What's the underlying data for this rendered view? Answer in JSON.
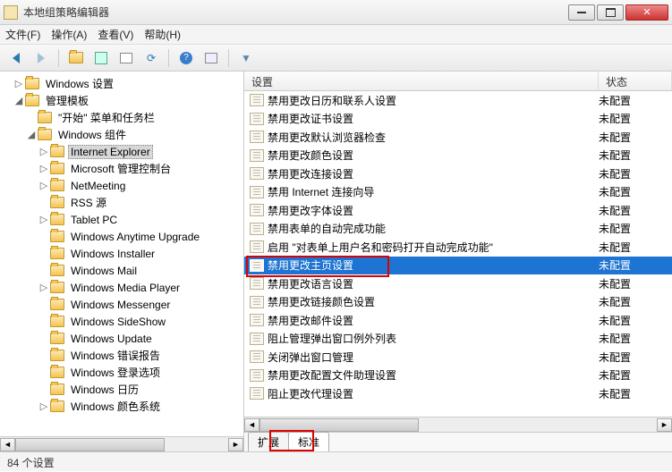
{
  "window": {
    "title": "本地组策略编辑器"
  },
  "menu": {
    "file": "文件(F)",
    "action": "操作(A)",
    "view": "查看(V)",
    "help": "帮助(H)"
  },
  "tree": {
    "n0": "Windows 设置",
    "n1": "管理模板",
    "n2": "\"开始\" 菜单和任务栏",
    "n3": "Windows 组件",
    "n4": "Internet Explorer",
    "n5": "Microsoft 管理控制台",
    "n6": "NetMeeting",
    "n7": "RSS 源",
    "n8": "Tablet PC",
    "n9": "Windows Anytime Upgrade",
    "n10": "Windows Installer",
    "n11": "Windows Mail",
    "n12": "Windows Media Player",
    "n13": "Windows Messenger",
    "n14": "Windows SideShow",
    "n15": "Windows Update",
    "n16": "Windows 错误报告",
    "n17": "Windows 登录选项",
    "n18": "Windows 日历",
    "n19": "Windows 颜色系统"
  },
  "cols": {
    "setting": "设置",
    "state": "状态"
  },
  "state_default": "未配置",
  "rows": {
    "r0": "禁用更改日历和联系人设置",
    "r1": "禁用更改证书设置",
    "r2": "禁用更改默认浏览器检查",
    "r3": "禁用更改颜色设置",
    "r4": "禁用更改连接设置",
    "r5": "禁用 Internet 连接向导",
    "r6": "禁用更改字体设置",
    "r7": "禁用表单的自动完成功能",
    "r8": "启用 \"对表单上用户名和密码打开自动完成功能\"",
    "r9": "禁用更改主页设置",
    "r10": "禁用更改语言设置",
    "r11": "禁用更改链接颜色设置",
    "r12": "禁用更改邮件设置",
    "r13": "阻止管理弹出窗口例外列表",
    "r14": "关闭弹出窗口管理",
    "r15": "禁用更改配置文件助理设置",
    "r16": "阻止更改代理设置"
  },
  "tabs": {
    "ext": "扩展",
    "std": "标准"
  },
  "status": "84 个设置"
}
